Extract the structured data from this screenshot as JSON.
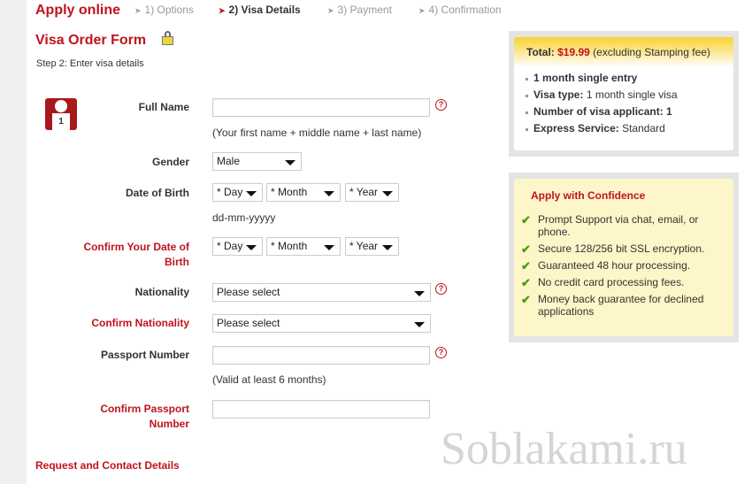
{
  "header": {
    "title": "Apply online",
    "steps": [
      {
        "label": "1) Options",
        "active": false
      },
      {
        "label": "2) Visa Details",
        "active": true
      },
      {
        "label": "3) Payment",
        "active": false
      },
      {
        "label": "4) Confirmation",
        "active": false
      }
    ]
  },
  "form": {
    "title": "Visa Order Form",
    "lock_icon": "lock-icon",
    "subtitle": "Step 2: Enter visa details",
    "applicant_number": "1",
    "full_name": {
      "label": "Full Name",
      "value": "",
      "hint": "(Your first name + middle name + last name)"
    },
    "gender": {
      "label": "Gender",
      "value": "Male"
    },
    "dob": {
      "label": "Date of Birth",
      "day": "* Day",
      "month": "* Month",
      "year": "* Year",
      "hint": "dd-mm-yyyyy"
    },
    "confirm_dob": {
      "label": "Confirm Your Date of Birth",
      "day": "* Day",
      "month": "* Month",
      "year": "* Year"
    },
    "nationality": {
      "label": "Nationality",
      "value": "Please select"
    },
    "confirm_nationality": {
      "label": "Confirm Nationality",
      "value": "Please select"
    },
    "passport": {
      "label": "Passport Number",
      "value": "",
      "hint": "(Valid at least 6 months)"
    },
    "confirm_passport": {
      "label": "Confirm Passport Number",
      "value": ""
    },
    "next_section": "Request and Contact Details"
  },
  "summary": {
    "total_label": "Total:",
    "total_value": "$19.99",
    "total_note": "(excluding Stamping fee)",
    "entry": "1 month single entry",
    "visa_type_label": "Visa type:",
    "visa_type_value": "1 month single visa",
    "applicants_label": "Number of visa applicant:",
    "applicants_value": "1",
    "express_label": "Express Service:",
    "express_value": "Standard"
  },
  "confidence": {
    "title": "Apply with Confidence",
    "items": [
      "Prompt Support via chat, email, or phone.",
      "Secure 128/256 bit SSL encryption.",
      "Guaranteed 48 hour processing.",
      "No credit card processing fees.",
      "Money back guarantee for declined applications"
    ]
  },
  "watermark": "Soblakami.ru",
  "colors": {
    "accent": "#c0131d",
    "check": "#4a9a1e",
    "panel_yellow": "#fdf6c8"
  }
}
